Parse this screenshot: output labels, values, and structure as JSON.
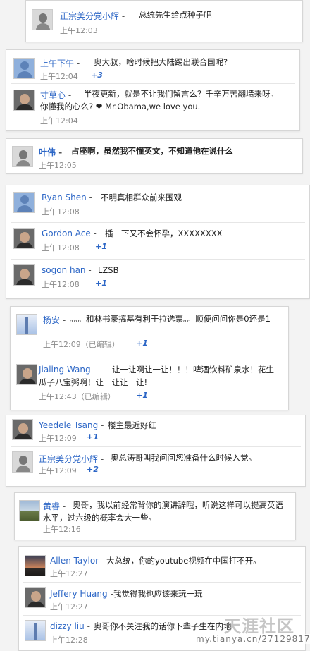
{
  "panels": {
    "p1": {
      "rows": [
        {
          "name": "正宗美分党小辉",
          "text": "总统先生给点种子吧",
          "time": "上午12:03",
          "plus": ""
        }
      ]
    },
    "p2": {
      "rows": [
        {
          "name": "上午下午",
          "text": "奥大叔，啥时候把大陆踢出联合国呢?",
          "time": "上午12:04",
          "plus": "+3"
        },
        {
          "name": "寸草心",
          "text": "半夜更新，就是不让我们留言么？千辛万苦翻墙来呀。你懂我的心么? ❤ Mr.Obama,we love you.",
          "time": "上午12:04",
          "plus": ""
        }
      ]
    },
    "p3": {
      "rows": [
        {
          "name": "叶伟",
          "text": "占座啊，虽然我不懂英文，不知道他在说什么",
          "time": "上午12:05",
          "plus": ""
        }
      ]
    },
    "p4": {
      "rows": [
        {
          "name": "Ryan Shen",
          "text": "不明真相群众前来围观",
          "time": "上午12:08",
          "plus": ""
        },
        {
          "name": "Gordon Ace",
          "text": "插一下又不会怀孕，XXXXXXXX",
          "time": "上午12:08",
          "plus": "+1"
        },
        {
          "name": "sogon han",
          "text": "LZSB",
          "time": "上午12:08",
          "plus": "+1"
        }
      ]
    },
    "p5": {
      "rows": [
        {
          "name": "杨安",
          "text": "。。。和林书豪搞基有利于拉选票。。顺便问问你是0还是1",
          "time": "上午12:09（已编辑）",
          "plus": "+1"
        },
        {
          "name": "Jialing Wang",
          "text": "让一让啊让一让！！！啤酒饮料矿泉水！花生瓜子八宝粥啊！让一让让一让!",
          "time": "上午12:43（已编辑）",
          "plus": "+1"
        }
      ]
    },
    "p6": {
      "rows": [
        {
          "name": "Yeedele Tsang",
          "text": "楼主最近好红",
          "time": "上午12:09",
          "plus": "+1"
        },
        {
          "name": "正宗美分党小辉",
          "text": "奥总涛哥叫我问问您准备什么时候入党。",
          "time": "上午12:09",
          "plus": "+2"
        }
      ]
    },
    "p7": {
      "rows": [
        {
          "name": "黄睿",
          "text": "奥哥，我以前经常背你的演讲辞哦，听说这样可以提高英语水平，过六级的概率会大一些。",
          "time": "上午12:16",
          "plus": ""
        }
      ]
    },
    "p8": {
      "rows": [
        {
          "name": "Allen Taylor",
          "text": "大总统，你的youtube视频在中国打不开。",
          "time": "上午12:27",
          "plus": ""
        },
        {
          "name": "Jeffery Huang",
          "text": "我觉得我也应该来玩一玩",
          "time": "上午12:27",
          "plus": ""
        },
        {
          "name": "dizzy liu",
          "text": "奥哥你不关注我的话你下辈子生在内地",
          "time": "上午12:28",
          "plus": ""
        }
      ]
    }
  },
  "watermark": {
    "logo": "天涯社区",
    "url": "my.tianya.cn/27129817"
  },
  "colors": {
    "name": "#2c66c6",
    "time": "#8a8a8a",
    "text": "#222222",
    "background": "#f3f3f3"
  }
}
